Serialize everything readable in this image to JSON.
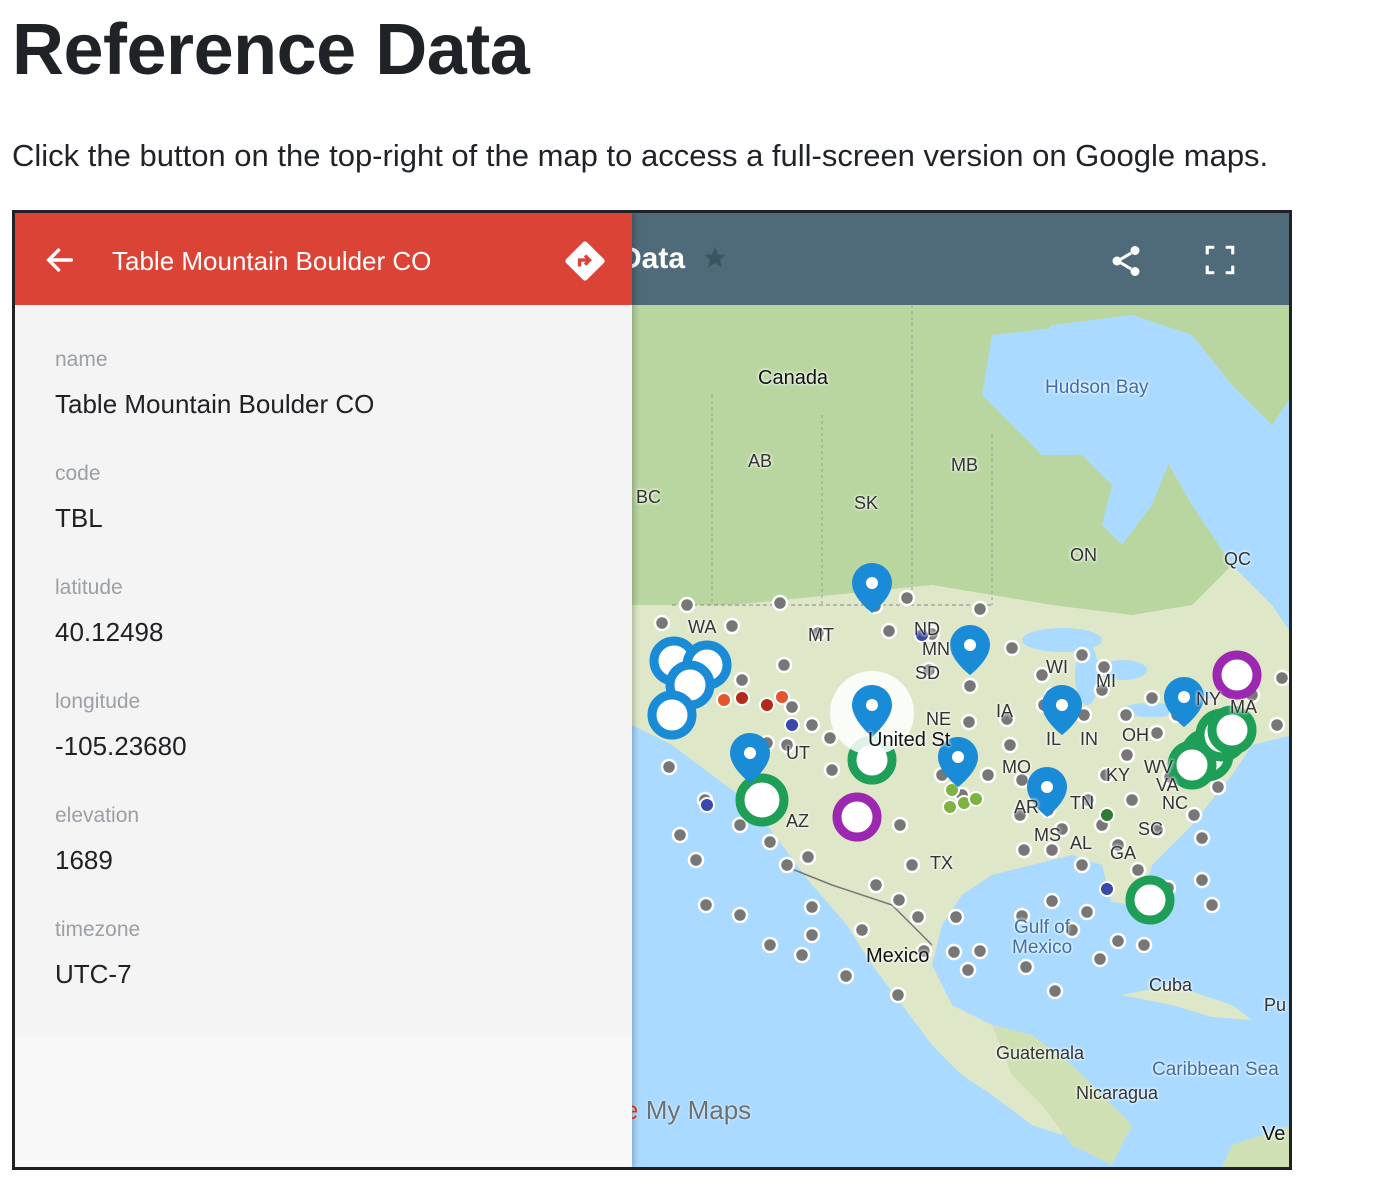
{
  "page": {
    "heading": "Reference Data",
    "intro": "Click the button on the top-right of the map to access a full-screen version on Google maps."
  },
  "map": {
    "title_visible": "Data",
    "logo_prefix": "e",
    "logo_text": "My Maps",
    "labels": [
      {
        "text": "Canada",
        "kind": "big"
      },
      {
        "text": "Hudson Bay",
        "kind": "water"
      },
      {
        "text": "AB",
        "kind": "region"
      },
      {
        "text": "MB",
        "kind": "region"
      },
      {
        "text": "BC",
        "kind": "region"
      },
      {
        "text": "SK",
        "kind": "region"
      },
      {
        "text": "ON",
        "kind": "region"
      },
      {
        "text": "QC",
        "kind": "region"
      },
      {
        "text": "WA",
        "kind": "region"
      },
      {
        "text": "MT",
        "kind": "region"
      },
      {
        "text": "ND",
        "kind": "region"
      },
      {
        "text": "SD",
        "kind": "region"
      },
      {
        "text": "MN",
        "kind": "region"
      },
      {
        "text": "WI",
        "kind": "region"
      },
      {
        "text": "MI",
        "kind": "region"
      },
      {
        "text": "NE",
        "kind": "region"
      },
      {
        "text": "IA",
        "kind": "region"
      },
      {
        "text": "IL",
        "kind": "region"
      },
      {
        "text": "IN",
        "kind": "region"
      },
      {
        "text": "OH",
        "kind": "region"
      },
      {
        "text": "UT",
        "kind": "region"
      },
      {
        "text": "MO",
        "kind": "region"
      },
      {
        "text": "KY",
        "kind": "region"
      },
      {
        "text": "WV",
        "kind": "region"
      },
      {
        "text": "VA",
        "kind": "region"
      },
      {
        "text": "AZ",
        "kind": "region"
      },
      {
        "text": "AR",
        "kind": "region"
      },
      {
        "text": "TN",
        "kind": "region"
      },
      {
        "text": "NC",
        "kind": "region"
      },
      {
        "text": "SC",
        "kind": "region"
      },
      {
        "text": "MS",
        "kind": "region"
      },
      {
        "text": "AL",
        "kind": "region"
      },
      {
        "text": "GA",
        "kind": "region"
      },
      {
        "text": "TX",
        "kind": "region"
      },
      {
        "text": "NY",
        "kind": "region"
      },
      {
        "text": "MA",
        "kind": "region"
      },
      {
        "text": "United St",
        "kind": "big"
      },
      {
        "text": "Gulf of",
        "kind": "water"
      },
      {
        "text": "Mexico",
        "kind": "water"
      },
      {
        "text": "Mexico",
        "kind": "big"
      },
      {
        "text": "Cuba",
        "kind": "region"
      },
      {
        "text": "Pu",
        "kind": "region"
      },
      {
        "text": "Guatemala",
        "kind": "region"
      },
      {
        "text": "Caribbean Sea",
        "kind": "water"
      },
      {
        "text": "Nicaragua",
        "kind": "region"
      },
      {
        "text": "Ve",
        "kind": "big"
      }
    ]
  },
  "panel": {
    "title": "Table Mountain Boulder CO",
    "fields": [
      {
        "label": "name",
        "value": "Table Mountain Boulder CO"
      },
      {
        "label": "code",
        "value": "TBL"
      },
      {
        "label": "latitude",
        "value": "40.12498"
      },
      {
        "label": "longitude",
        "value": "-105.23680"
      },
      {
        "label": "elevation",
        "value": "1689"
      },
      {
        "label": "timezone",
        "value": "UTC-7"
      }
    ]
  },
  "colors": {
    "panel_header": "#dc4337",
    "map_header": "#4f6a78",
    "pin_blue": "#1a8bd6",
    "ring_green": "#1e9e57",
    "ring_purple": "#9c27b0",
    "dot_gray": "#777777",
    "water": "#aadaff",
    "land": "#dfe7c9"
  },
  "icons": [
    "back-arrow-icon",
    "directions-icon",
    "star-icon",
    "share-icon",
    "fullscreen-icon"
  ]
}
